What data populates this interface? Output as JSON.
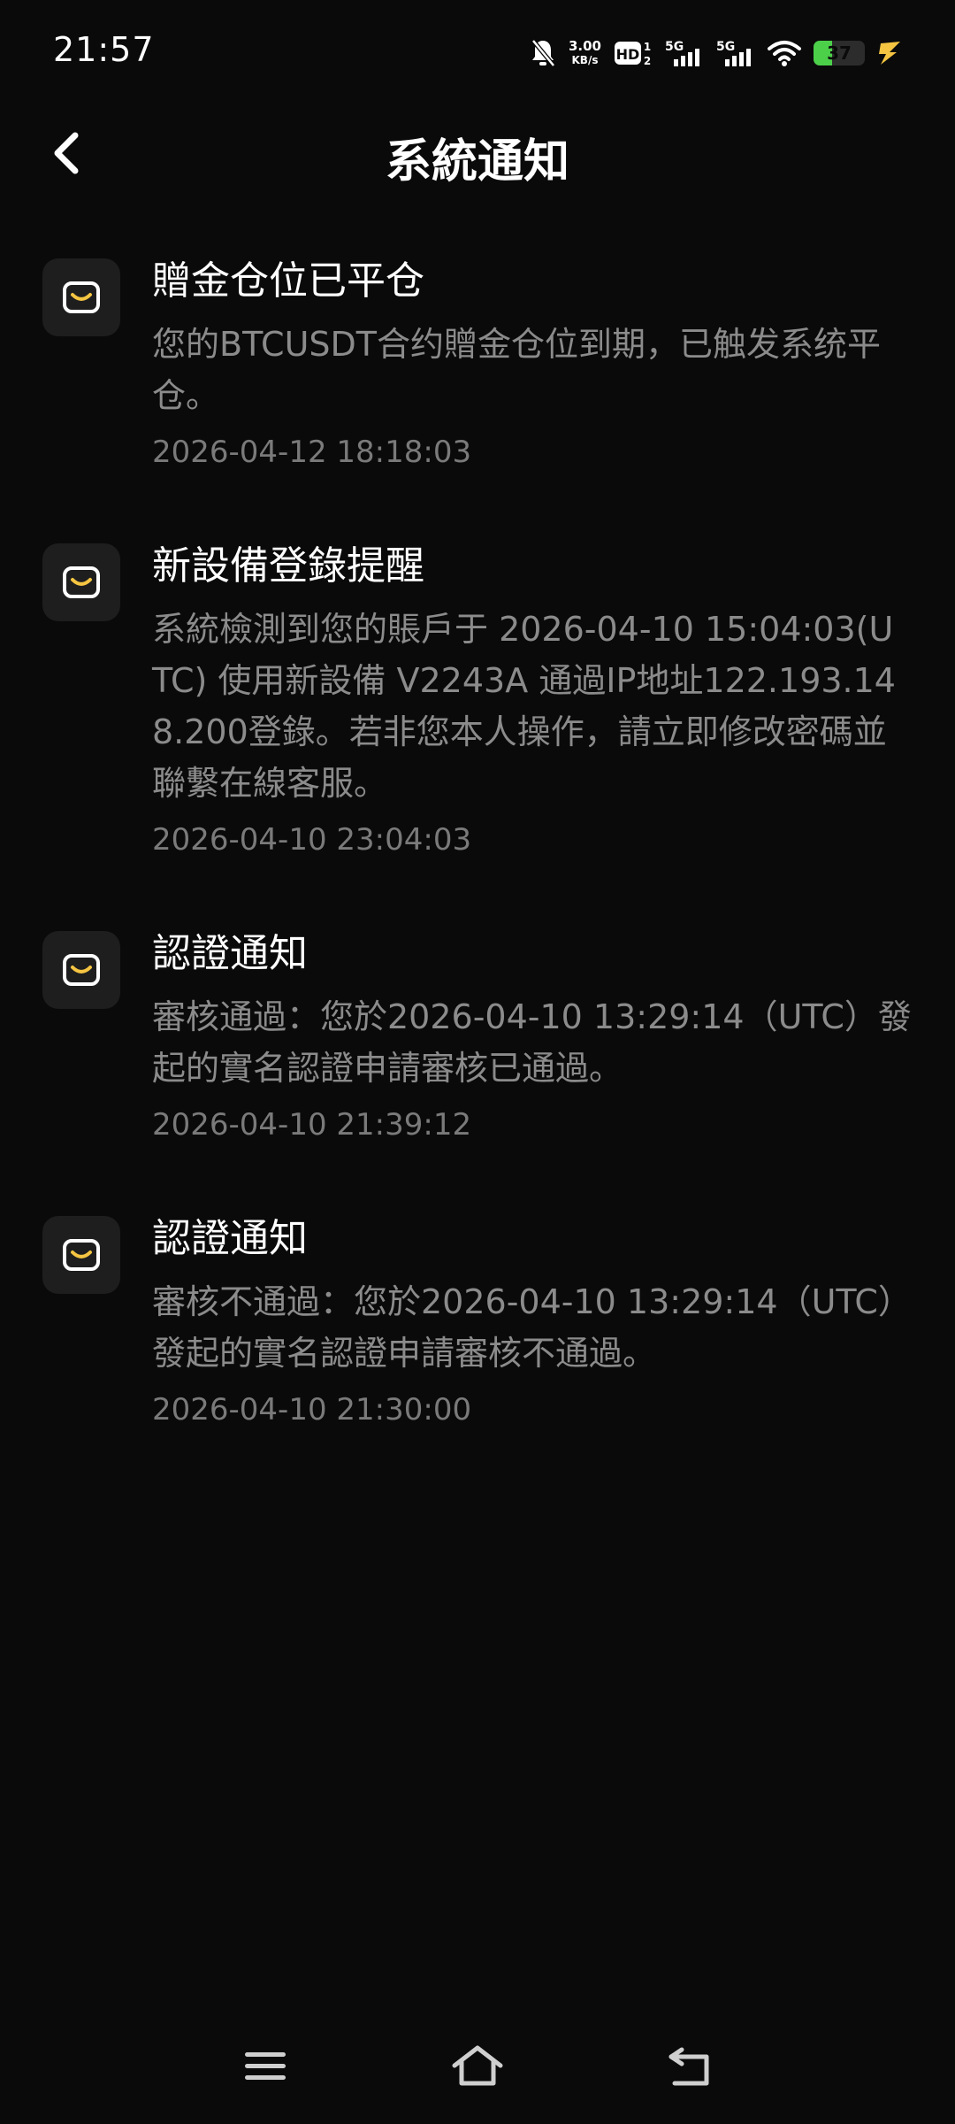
{
  "status_bar": {
    "time": "21:57",
    "net_speed_value": "3.00",
    "net_speed_unit": "KB/s",
    "battery_level": "37",
    "battery_fraction": 0.37,
    "icons": [
      "bell-off-icon",
      "hd-icon",
      "signal-5g-icon",
      "signal-5g-icon",
      "wifi-icon",
      "battery-icon",
      "charging-icon"
    ]
  },
  "header": {
    "title": "系統通知"
  },
  "notifications": [
    {
      "title": "贈金仓位已平仓",
      "content": "您的BTCUSDT合约贈金仓位到期，已触发系统平仓。",
      "time": "2026-04-12 18:18:03"
    },
    {
      "title": "新設備登錄提醒",
      "content": "系統檢測到您的賬戶于 2026-04-10 15:04:03(UTC) 使用新設備 V2243A 通過IP地址122.193.148.200登錄。若非您本人操作，請立即修改密碼並聯繫在線客服。",
      "time": "2026-04-10 23:04:03"
    },
    {
      "title": "認證通知",
      "content": "審核通過：您於2026-04-10 13:29:14（UTC）發起的實名認證申請審核已通過。",
      "time": "2026-04-10 21:39:12"
    },
    {
      "title": "認證通知",
      "content": "審核不通過：您於2026-04-10 13:29:14（UTC）發起的實名認證申請審核不通過。",
      "time": "2026-04-10 21:30:00"
    }
  ],
  "colors": {
    "background": "#0a0a0a",
    "icon_tile": "#1e1e1e",
    "accent_yellow": "#f5c542",
    "battery_green": "#4cd04a",
    "muted_text": "#8b8b8b"
  },
  "nav": [
    "menu-icon",
    "home-icon",
    "back-nav-icon"
  ]
}
